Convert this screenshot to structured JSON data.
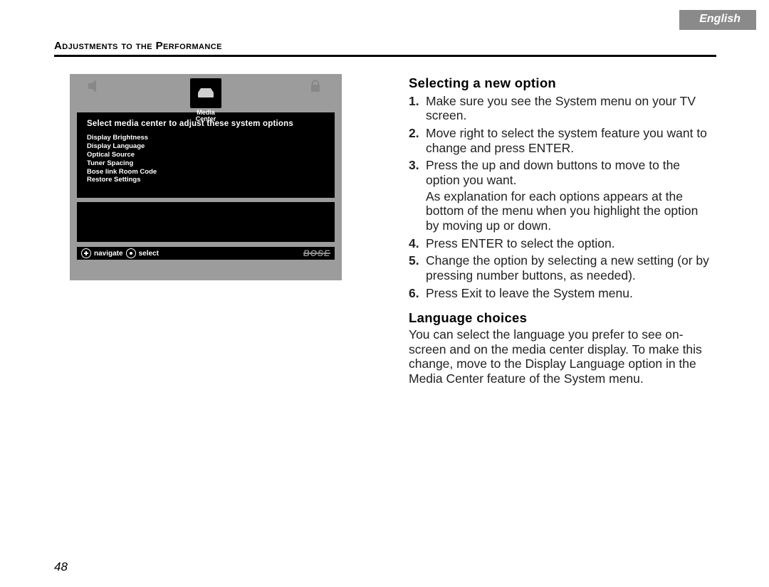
{
  "lang_tab": "English",
  "section_header": "Adjustments to the Performance",
  "page_number": "48",
  "tv": {
    "media_label_line1": "Media",
    "media_label_line2": "Center",
    "panel_title": "Select media center to adjust these system options",
    "options": [
      "Display Brightness",
      "Display Language",
      "Optical Source",
      "Tuner Spacing",
      "Bose link Room Code",
      "Restore Settings"
    ],
    "footer_navigate": "navigate",
    "footer_select": "select",
    "brand": "BOSE"
  },
  "content": {
    "h1": "Selecting a new option",
    "steps": [
      "Make sure you see the System menu on your TV screen.",
      "Move right to select the system feature you want to change and press ENTER.",
      "Press the up and down buttons to move to the option you want.",
      "Press ENTER to select the option.",
      "Change the option by selecting a new setting (or by pressing number buttons, as needed).",
      "Press Exit to leave the System menu."
    ],
    "step3_sub": "As explanation for each options appears at the bottom of the menu when you highlight the option by moving up or down.",
    "h2": "Language choices",
    "lang_p": "You can select the language you prefer to see on-screen and on the media center display. To make this change, move to the Display Language option in the Media Center feature of the System menu."
  }
}
